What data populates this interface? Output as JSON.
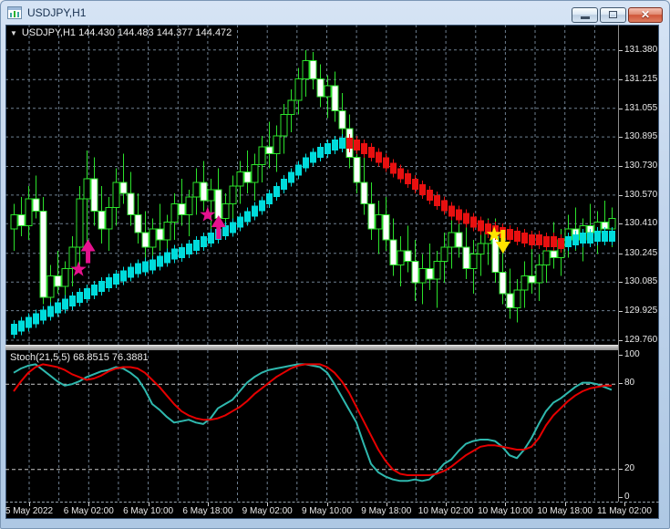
{
  "window": {
    "title": "USDJPY,H1"
  },
  "icons": {
    "dropdown": "▼"
  },
  "chart": {
    "symbol_label": "USDJPY,H1 144.430 144.483 144.377 144.472"
  },
  "stoch": {
    "label": "Stoch(21,5,5) 68.8515 76.3881",
    "axis_ticks": [
      100,
      80,
      20,
      0
    ]
  },
  "price_axis": {
    "ticks": [
      131.38,
      131.215,
      131.055,
      130.895,
      130.73,
      130.57,
      130.41,
      130.245,
      130.085,
      129.925,
      129.76
    ]
  },
  "time_axis": {
    "labels": [
      "5 May 2022",
      "6 May 02:00",
      "6 May 10:00",
      "6 May 18:00",
      "9 May 02:00",
      "9 May 10:00",
      "9 May 18:00",
      "10 May 02:00",
      "10 May 10:00",
      "10 May 18:00",
      "11 May 02:00"
    ]
  },
  "colors": {
    "background": "#000000",
    "grid": "#6E7F90",
    "bar_outline": "#2BE22B",
    "bull_body": "#000000",
    "bear_body": "#FFFFFF",
    "trend_up": "#00DCDC",
    "trend_down": "#E81010",
    "stoch_main": "#2FB8AE",
    "stoch_signal": "#E60000",
    "buy_signal": "#E6128E",
    "sell_signal": "#FFE400",
    "stoch_level": "#C8C8C8",
    "axis_text": "#E8E8E8"
  },
  "chart_data": {
    "type": "candlestick",
    "title": "USDJPY,H1",
    "symbol": "USDJPY",
    "timeframe": "H1",
    "ylim": [
      129.72,
      131.42
    ],
    "price_step": 0.165,
    "candles": [
      [
        130.38,
        130.52,
        130.26,
        130.46
      ],
      [
        130.46,
        130.56,
        130.34,
        130.4
      ],
      [
        130.4,
        130.62,
        130.32,
        130.55
      ],
      [
        130.55,
        130.68,
        130.44,
        130.48
      ],
      [
        130.48,
        130.56,
        129.96,
        130.0
      ],
      [
        130.0,
        130.18,
        129.9,
        130.12
      ],
      [
        130.12,
        130.26,
        130.02,
        130.06
      ],
      [
        130.06,
        130.2,
        129.97,
        130.16
      ],
      [
        130.16,
        130.34,
        130.06,
        130.28
      ],
      [
        130.28,
        130.62,
        130.18,
        130.55
      ],
      [
        130.55,
        130.82,
        130.24,
        130.66
      ],
      [
        130.66,
        130.78,
        130.4,
        130.48
      ],
      [
        130.48,
        130.62,
        130.3,
        130.38
      ],
      [
        130.38,
        130.56,
        130.26,
        130.5
      ],
      [
        130.5,
        130.72,
        130.4,
        130.64
      ],
      [
        130.64,
        130.8,
        130.52,
        130.58
      ],
      [
        130.58,
        130.7,
        130.4,
        130.46
      ],
      [
        130.46,
        130.58,
        130.3,
        130.36
      ],
      [
        130.36,
        130.48,
        130.22,
        130.28
      ],
      [
        130.28,
        130.44,
        130.16,
        130.38
      ],
      [
        130.38,
        130.52,
        130.26,
        130.32
      ],
      [
        130.32,
        130.46,
        130.18,
        130.42
      ],
      [
        130.42,
        130.58,
        130.32,
        130.52
      ],
      [
        130.52,
        130.66,
        130.4,
        130.46
      ],
      [
        130.46,
        130.6,
        130.34,
        130.56
      ],
      [
        130.56,
        130.72,
        130.46,
        130.64
      ],
      [
        130.64,
        130.76,
        130.48,
        130.54
      ],
      [
        130.54,
        130.66,
        130.38,
        130.6
      ],
      [
        130.6,
        130.72,
        130.34,
        130.44
      ],
      [
        130.44,
        130.58,
        130.32,
        130.52
      ],
      [
        130.52,
        130.68,
        130.44,
        130.62
      ],
      [
        130.62,
        130.76,
        130.52,
        130.7
      ],
      [
        130.7,
        130.82,
        130.58,
        130.64
      ],
      [
        130.64,
        130.8,
        130.54,
        130.74
      ],
      [
        130.74,
        130.9,
        130.64,
        130.84
      ],
      [
        130.84,
        130.98,
        130.72,
        130.8
      ],
      [
        130.8,
        130.96,
        130.7,
        130.9
      ],
      [
        130.9,
        131.08,
        130.8,
        131.02
      ],
      [
        131.02,
        131.16,
        130.92,
        131.1
      ],
      [
        131.1,
        131.28,
        131.02,
        131.22
      ],
      [
        131.22,
        131.38,
        131.12,
        131.32
      ],
      [
        131.32,
        131.37,
        131.16,
        131.22
      ],
      [
        131.22,
        131.3,
        131.06,
        131.12
      ],
      [
        131.12,
        131.24,
        131.0,
        131.18
      ],
      [
        131.18,
        131.26,
        130.98,
        131.04
      ],
      [
        131.04,
        131.14,
        130.88,
        130.94
      ],
      [
        130.94,
        131.02,
        130.72,
        130.78
      ],
      [
        130.78,
        130.9,
        130.58,
        130.64
      ],
      [
        130.64,
        130.78,
        130.46,
        130.52
      ],
      [
        130.52,
        130.64,
        130.32,
        130.38
      ],
      [
        130.38,
        130.54,
        130.24,
        130.46
      ],
      [
        130.46,
        130.56,
        130.26,
        130.32
      ],
      [
        130.32,
        130.44,
        130.12,
        130.18
      ],
      [
        130.18,
        130.34,
        130.06,
        130.26
      ],
      [
        130.26,
        130.4,
        130.14,
        130.2
      ],
      [
        130.2,
        130.32,
        129.98,
        130.08
      ],
      [
        130.08,
        130.24,
        129.96,
        130.16
      ],
      [
        130.16,
        130.3,
        130.04,
        130.1
      ],
      [
        130.1,
        130.26,
        129.94,
        130.2
      ],
      [
        130.2,
        130.36,
        130.08,
        130.28
      ],
      [
        130.28,
        130.44,
        130.16,
        130.36
      ],
      [
        130.36,
        130.48,
        130.22,
        130.28
      ],
      [
        130.28,
        130.42,
        130.1,
        130.16
      ],
      [
        130.16,
        130.32,
        130.02,
        130.24
      ],
      [
        130.24,
        130.38,
        130.12,
        130.3
      ],
      [
        130.3,
        130.44,
        130.18,
        130.36
      ],
      [
        130.36,
        130.44,
        130.08,
        130.14
      ],
      [
        130.14,
        130.26,
        129.96,
        130.02
      ],
      [
        130.02,
        130.16,
        129.88,
        129.94
      ],
      [
        129.94,
        130.1,
        129.86,
        130.04
      ],
      [
        130.04,
        130.2,
        129.94,
        130.12
      ],
      [
        130.12,
        130.28,
        130.02,
        130.08
      ],
      [
        130.08,
        130.24,
        129.98,
        130.18
      ],
      [
        130.18,
        130.34,
        130.08,
        130.26
      ],
      [
        130.26,
        130.42,
        130.16,
        130.22
      ],
      [
        130.22,
        130.38,
        130.12,
        130.32
      ],
      [
        130.32,
        130.46,
        130.22,
        130.38
      ],
      [
        130.38,
        130.5,
        130.26,
        130.32
      ],
      [
        130.32,
        130.44,
        130.2,
        130.4
      ],
      [
        130.4,
        130.52,
        130.3,
        130.36
      ],
      [
        130.36,
        130.48,
        130.24,
        130.42
      ],
      [
        130.42,
        130.54,
        130.32,
        130.38
      ],
      [
        130.38,
        130.5,
        130.28,
        130.44
      ]
    ],
    "trend_blocks": {
      "values": [
        129.82,
        129.84,
        129.86,
        129.88,
        129.9,
        129.92,
        129.94,
        129.96,
        129.98,
        130.0,
        130.02,
        130.04,
        130.06,
        130.08,
        130.1,
        130.12,
        130.14,
        130.16,
        130.17,
        130.18,
        130.2,
        130.22,
        130.24,
        130.25,
        130.27,
        130.29,
        130.31,
        130.33,
        130.35,
        130.37,
        130.39,
        130.42,
        130.45,
        130.48,
        130.51,
        130.55,
        130.59,
        130.63,
        130.67,
        130.71,
        130.75,
        130.78,
        130.81,
        130.83,
        130.85,
        130.86,
        130.86,
        130.85,
        130.83,
        130.81,
        130.78,
        130.75,
        130.72,
        130.69,
        130.66,
        130.63,
        130.6,
        130.57,
        130.54,
        130.51,
        130.48,
        130.46,
        130.44,
        130.42,
        130.4,
        130.38,
        130.37,
        130.36,
        130.35,
        130.34,
        130.33,
        130.32,
        130.32,
        130.31,
        130.31,
        130.3,
        130.31,
        130.32,
        130.33,
        130.33,
        130.34,
        130.34,
        130.34
      ],
      "states": "uuuuuuuuuuuuuuuuuuuuuuuuuuuuuuuuuuuuuuuuuuuuuudddddddddddddddddddddddddddddduuuuuuuu"
    },
    "signals": [
      {
        "dir": "up",
        "color": "buy_signal",
        "star": {
          "bar": 8.9,
          "price": 130.155
        },
        "arrow": {
          "bar": 10.2,
          "price": 130.19
        }
      },
      {
        "dir": "up",
        "color": "buy_signal",
        "star": {
          "bar": 26.6,
          "price": 130.46
        },
        "arrow": {
          "bar": 28.1,
          "price": 130.325
        }
      },
      {
        "dir": "down",
        "color": "sell_signal",
        "star": {
          "bar": 65.9,
          "price": 130.35
        },
        "arrow": {
          "bar": 67.1,
          "price": 130.376
        }
      }
    ],
    "stochastic": {
      "params": "21,5,5",
      "current_main": 68.8515,
      "current_signal": 76.3881,
      "levels": [
        80,
        20
      ],
      "range": [
        0,
        100
      ],
      "main": [
        88,
        91,
        93,
        94,
        90,
        86,
        82,
        79,
        80,
        82,
        85,
        87,
        89,
        90,
        92,
        91,
        88,
        84,
        76,
        66,
        62,
        57,
        53,
        54,
        55,
        53,
        52,
        56,
        63,
        66,
        69,
        75,
        81,
        85,
        88,
        90,
        91,
        92,
        93,
        94,
        94,
        93,
        92,
        88,
        80,
        71,
        62,
        53,
        38,
        24,
        18,
        15,
        13,
        12,
        12,
        13,
        12,
        13,
        18,
        24,
        27,
        33,
        38,
        40,
        41,
        41,
        40,
        36,
        30,
        28,
        34,
        42,
        52,
        61,
        67,
        70,
        74,
        78,
        81,
        81,
        80,
        78,
        76
      ],
      "signal": [
        75,
        82,
        88,
        92,
        94,
        93,
        92,
        90,
        87,
        85,
        83,
        84,
        86,
        89,
        91,
        92,
        92,
        91,
        88,
        83,
        78,
        72,
        66,
        61,
        58,
        56,
        55,
        55,
        56,
        58,
        61,
        64,
        68,
        73,
        77,
        81,
        85,
        88,
        91,
        93,
        94,
        94,
        94,
        92,
        88,
        82,
        74,
        64,
        54,
        44,
        34,
        26,
        20,
        17,
        16,
        16,
        16,
        16,
        17,
        19,
        22,
        26,
        30,
        33,
        36,
        37,
        37,
        36,
        35,
        34,
        34,
        36,
        42,
        51,
        58,
        63,
        68,
        72,
        75,
        77,
        78,
        79,
        79
      ]
    }
  }
}
